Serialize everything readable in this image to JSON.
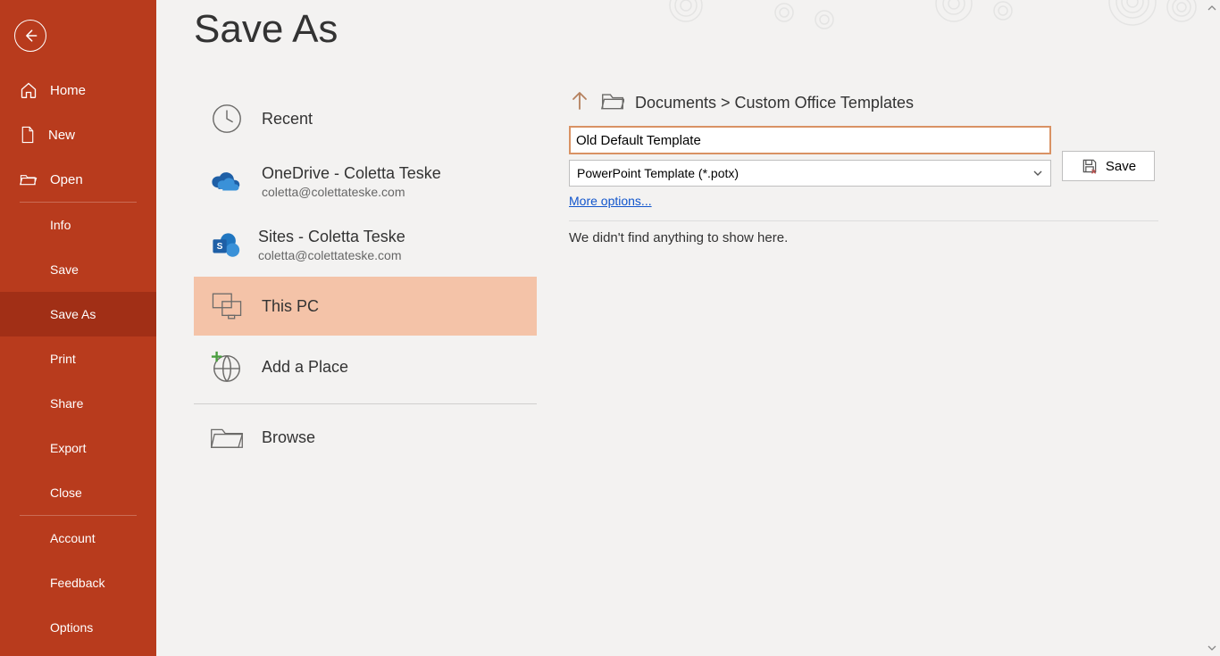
{
  "sidebar": {
    "home": "Home",
    "new": "New",
    "open": "Open",
    "info": "Info",
    "save": "Save",
    "save_as": "Save As",
    "print": "Print",
    "share": "Share",
    "export": "Export",
    "close": "Close",
    "account": "Account",
    "feedback": "Feedback",
    "options": "Options"
  },
  "page_title": "Save As",
  "locations": {
    "recent": "Recent",
    "onedrive": {
      "primary": "OneDrive - Coletta Teske",
      "secondary": "coletta@colettateske.com"
    },
    "sites": {
      "primary": "Sites - Coletta Teske",
      "secondary": "coletta@colettateske.com"
    },
    "thispc": "This PC",
    "addplace": "Add a Place",
    "browse": "Browse"
  },
  "breadcrumb": "Documents > Custom Office Templates",
  "filename_value": "Old Default Template",
  "filetype_value": "PowerPoint Template (*.potx)",
  "more_options": "More options...",
  "save_button": "Save",
  "empty_message": "We didn't find anything to show here."
}
